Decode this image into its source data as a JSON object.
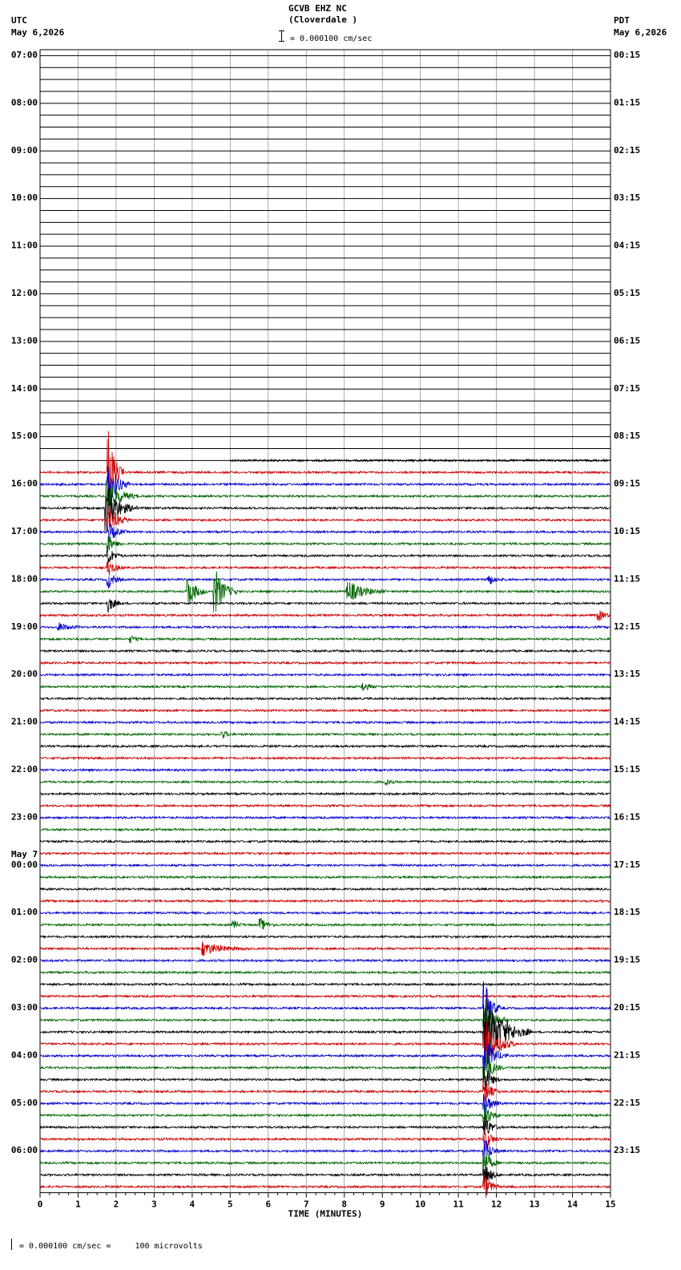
{
  "header": {
    "station": "GCVB EHZ NC",
    "location": "(Cloverdale )",
    "scale": "= 0.000100 cm/sec",
    "left_tz": "UTC",
    "left_date": "May 6,2026",
    "right_tz": "PDT",
    "right_date": "May 6,2026"
  },
  "footer": {
    "scale_text": "= 0.000100 cm/sec =     100 microvolts"
  },
  "chart_data": {
    "type": "line",
    "title": "GCVB EHZ NC (Cloverdale )",
    "xlabel": "TIME (MINUTES)",
    "xlim": [
      0,
      15
    ],
    "x_ticks": [
      "0",
      "1",
      "2",
      "3",
      "4",
      "5",
      "6",
      "7",
      "8",
      "9",
      "10",
      "11",
      "12",
      "13",
      "14",
      "15"
    ],
    "rows_per_hour": 4,
    "total_rows": 96,
    "data_start": {
      "row": 34,
      "minute": 5
    },
    "trace_colors": [
      "#0000cc",
      "#006600",
      "#000000",
      "#cc0000"
    ],
    "left_labels": [
      {
        "row": 0,
        "text": "07:00"
      },
      {
        "row": 4,
        "text": "08:00"
      },
      {
        "row": 8,
        "text": "09:00"
      },
      {
        "row": 12,
        "text": "10:00"
      },
      {
        "row": 16,
        "text": "11:00"
      },
      {
        "row": 20,
        "text": "12:00"
      },
      {
        "row": 24,
        "text": "13:00"
      },
      {
        "row": 28,
        "text": "14:00"
      },
      {
        "row": 32,
        "text": "15:00"
      },
      {
        "row": 36,
        "text": "16:00"
      },
      {
        "row": 40,
        "text": "17:00"
      },
      {
        "row": 44,
        "text": "18:00"
      },
      {
        "row": 48,
        "text": "19:00"
      },
      {
        "row": 52,
        "text": "20:00"
      },
      {
        "row": 56,
        "text": "21:00"
      },
      {
        "row": 60,
        "text": "22:00"
      },
      {
        "row": 64,
        "text": "23:00"
      },
      {
        "row": 68,
        "text": "00:00",
        "date": "May 7"
      },
      {
        "row": 72,
        "text": "01:00"
      },
      {
        "row": 76,
        "text": "02:00"
      },
      {
        "row": 80,
        "text": "03:00"
      },
      {
        "row": 84,
        "text": "04:00"
      },
      {
        "row": 88,
        "text": "05:00"
      },
      {
        "row": 92,
        "text": "06:00"
      }
    ],
    "right_labels": [
      {
        "row": 0,
        "text": "00:15"
      },
      {
        "row": 4,
        "text": "01:15"
      },
      {
        "row": 8,
        "text": "02:15"
      },
      {
        "row": 12,
        "text": "03:15"
      },
      {
        "row": 16,
        "text": "04:15"
      },
      {
        "row": 20,
        "text": "05:15"
      },
      {
        "row": 24,
        "text": "06:15"
      },
      {
        "row": 28,
        "text": "07:15"
      },
      {
        "row": 32,
        "text": "08:15"
      },
      {
        "row": 36,
        "text": "09:15"
      },
      {
        "row": 40,
        "text": "10:15"
      },
      {
        "row": 44,
        "text": "11:15"
      },
      {
        "row": 48,
        "text": "12:15"
      },
      {
        "row": 52,
        "text": "13:15"
      },
      {
        "row": 56,
        "text": "14:15"
      },
      {
        "row": 60,
        "text": "15:15"
      },
      {
        "row": 64,
        "text": "16:15"
      },
      {
        "row": 68,
        "text": "17:15"
      },
      {
        "row": 72,
        "text": "18:15"
      },
      {
        "row": 76,
        "text": "19:15"
      },
      {
        "row": 80,
        "text": "20:15"
      },
      {
        "row": 84,
        "text": "21:15"
      },
      {
        "row": 88,
        "text": "22:15"
      },
      {
        "row": 92,
        "text": "23:15"
      }
    ],
    "events": [
      {
        "row": 35,
        "minute": 1.8,
        "amp": 4.5,
        "dur": 0.4
      },
      {
        "row": 36,
        "minute": 1.8,
        "amp": 2.0,
        "dur": 0.6
      },
      {
        "row": 37,
        "minute": 1.78,
        "amp": 1.6,
        "dur": 0.8
      },
      {
        "row": 38,
        "minute": 1.75,
        "amp": 2.2,
        "dur": 0.8
      },
      {
        "row": 39,
        "minute": 1.8,
        "amp": 1.4,
        "dur": 0.6
      },
      {
        "row": 40,
        "minute": 1.8,
        "amp": 1.0,
        "dur": 0.5
      },
      {
        "row": 41,
        "minute": 1.8,
        "amp": 0.8,
        "dur": 0.4
      },
      {
        "row": 42,
        "minute": 1.8,
        "amp": 0.8,
        "dur": 0.4
      },
      {
        "row": 43,
        "minute": 1.8,
        "amp": 0.8,
        "dur": 0.4
      },
      {
        "row": 44,
        "minute": 1.8,
        "amp": 0.8,
        "dur": 0.4
      },
      {
        "row": 45,
        "minute": 4.6,
        "amp": 2.2,
        "dur": 0.6
      },
      {
        "row": 45,
        "minute": 3.9,
        "amp": 1.5,
        "dur": 0.5
      },
      {
        "row": 45,
        "minute": 8.1,
        "amp": 1.0,
        "dur": 1.0
      },
      {
        "row": 44,
        "minute": 11.8,
        "amp": 0.5,
        "dur": 0.4
      },
      {
        "row": 46,
        "minute": 1.8,
        "amp": 0.8,
        "dur": 0.4
      },
      {
        "row": 47,
        "minute": 14.7,
        "amp": 0.5,
        "dur": 0.4
      },
      {
        "row": 48,
        "minute": 0.5,
        "amp": 0.4,
        "dur": 0.6
      },
      {
        "row": 49,
        "minute": 2.4,
        "amp": 0.3,
        "dur": 0.3
      },
      {
        "row": 53,
        "minute": 8.5,
        "amp": 0.4,
        "dur": 0.4
      },
      {
        "row": 57,
        "minute": 4.8,
        "amp": 0.4,
        "dur": 0.3
      },
      {
        "row": 61,
        "minute": 9.1,
        "amp": 0.3,
        "dur": 0.3
      },
      {
        "row": 73,
        "minute": 5.8,
        "amp": 0.6,
        "dur": 0.4
      },
      {
        "row": 73,
        "minute": 5.1,
        "amp": 0.4,
        "dur": 0.3
      },
      {
        "row": 75,
        "minute": 4.3,
        "amp": 0.6,
        "dur": 1.2
      },
      {
        "row": 80,
        "minute": 11.7,
        "amp": 3.0,
        "dur": 0.4
      },
      {
        "row": 81,
        "minute": 11.7,
        "amp": 2.4,
        "dur": 0.6
      },
      {
        "row": 82,
        "minute": 11.7,
        "amp": 3.5,
        "dur": 1.2
      },
      {
        "row": 83,
        "minute": 11.7,
        "amp": 2.5,
        "dur": 0.8
      },
      {
        "row": 84,
        "minute": 11.7,
        "amp": 1.8,
        "dur": 0.6
      },
      {
        "row": 85,
        "minute": 11.7,
        "amp": 1.6,
        "dur": 0.5
      },
      {
        "row": 86,
        "minute": 11.7,
        "amp": 1.4,
        "dur": 0.4
      },
      {
        "row": 87,
        "minute": 11.7,
        "amp": 1.2,
        "dur": 0.4
      },
      {
        "row": 88,
        "minute": 11.7,
        "amp": 1.2,
        "dur": 0.4
      },
      {
        "row": 89,
        "minute": 11.7,
        "amp": 1.2,
        "dur": 0.4
      },
      {
        "row": 90,
        "minute": 11.7,
        "amp": 1.2,
        "dur": 0.4
      },
      {
        "row": 91,
        "minute": 11.7,
        "amp": 1.2,
        "dur": 0.4
      },
      {
        "row": 92,
        "minute": 11.7,
        "amp": 1.2,
        "dur": 0.4
      },
      {
        "row": 93,
        "minute": 11.7,
        "amp": 1.2,
        "dur": 0.4
      },
      {
        "row": 94,
        "minute": 11.7,
        "amp": 1.2,
        "dur": 0.4
      },
      {
        "row": 95,
        "minute": 11.7,
        "amp": 1.2,
        "dur": 0.4
      }
    ]
  }
}
